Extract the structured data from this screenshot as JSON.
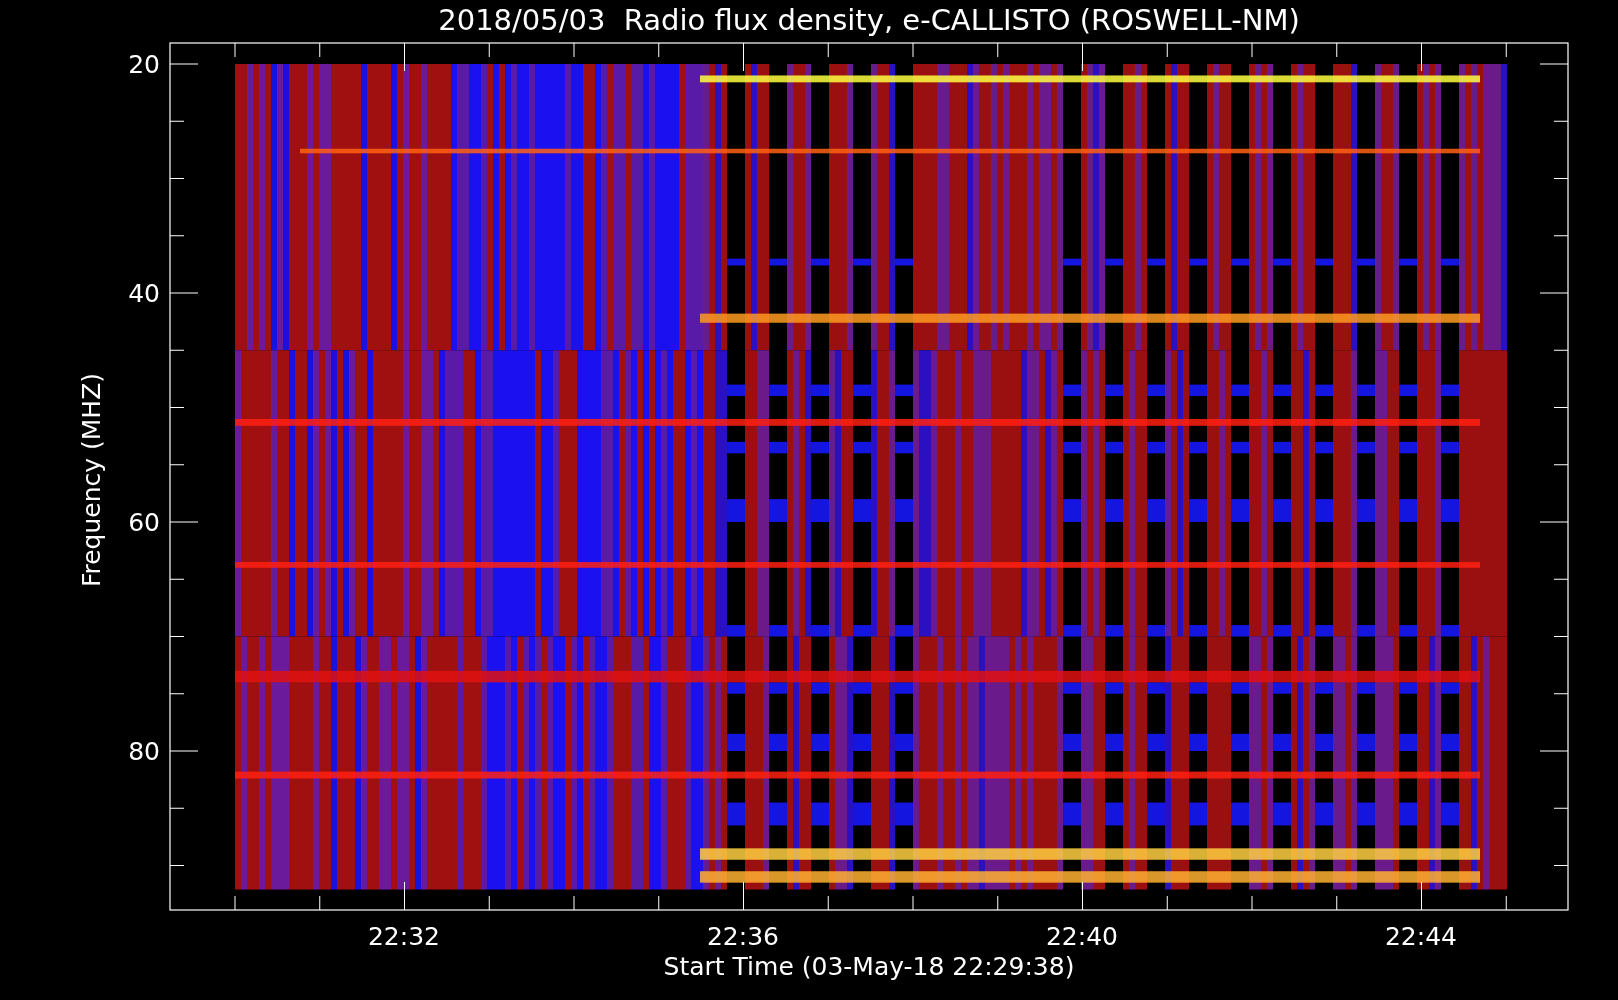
{
  "title": "2018/05/03  Radio flux density, e-CALLISTO (ROSWELL-NM)",
  "y_axis": {
    "label": "Frequency (MHZ)",
    "ticks": [
      "20",
      "40",
      "60",
      "80"
    ]
  },
  "x_axis": {
    "label": "Start Time (03-May-18 22:29:38)",
    "ticks": [
      "22:32",
      "22:36",
      "22:40",
      "22:44"
    ]
  }
}
